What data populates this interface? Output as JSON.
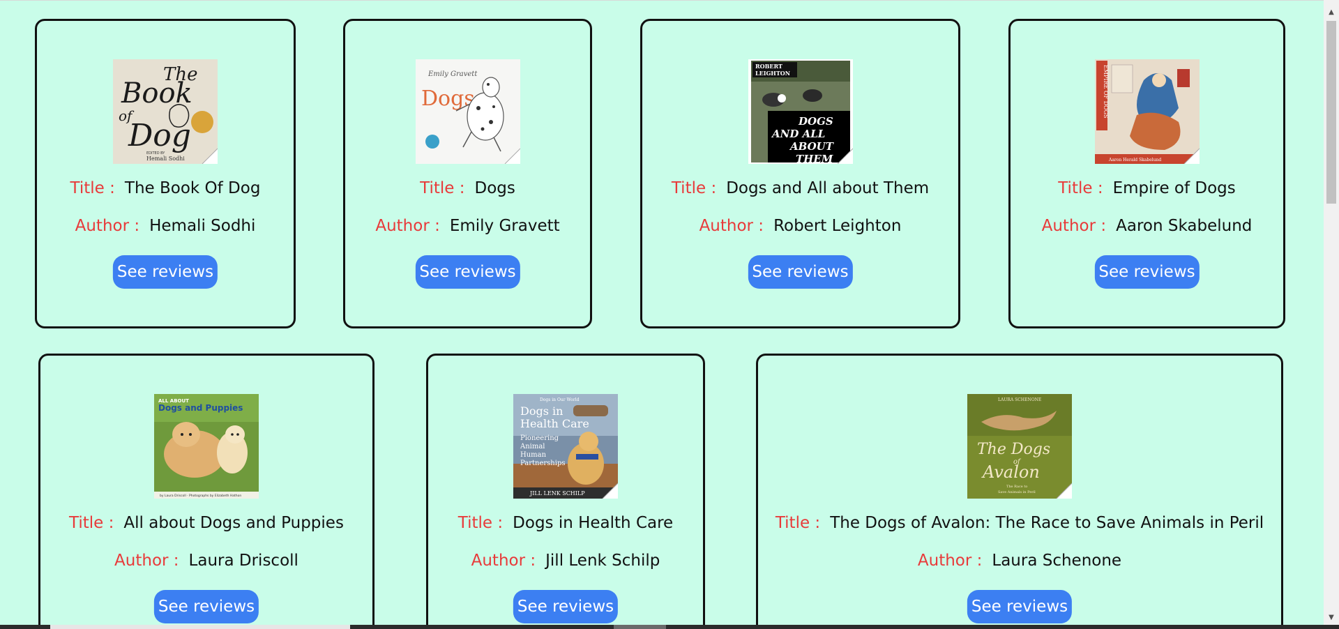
{
  "labels": {
    "title": "Title :",
    "author": "Author :",
    "button": "See reviews"
  },
  "books": [
    {
      "title": "The Book Of Dog",
      "author": "Hemali Sodhi"
    },
    {
      "title": "Dogs",
      "author": "Emily Gravett"
    },
    {
      "title": "Dogs and All about Them",
      "author": "Robert Leighton"
    },
    {
      "title": "Empire of Dogs",
      "author": "Aaron Skabelund"
    },
    {
      "title": "All about Dogs and Puppies",
      "author": "Laura Driscoll"
    },
    {
      "title": "Dogs in Health Care",
      "author": "Jill Lenk Schilp"
    },
    {
      "title": "The Dogs of Avalon: The Race to Save Animals in Peril",
      "author": "Laura Schenone"
    }
  ],
  "covers": {
    "book1": {
      "line1": "The",
      "line2": "Book",
      "line3": "of",
      "line4": "Dog",
      "editor": "EDITED BY",
      "editor_name": "Hemali Sodhi"
    },
    "book2": {
      "author": "Emily Gravett",
      "title": "Dogs"
    },
    "book3": {
      "author1": "ROBERT",
      "author2": "LEIGHTON",
      "line1": "DOGS",
      "line2": "AND ALL",
      "line3": "ABOUT",
      "line4": "THEM"
    },
    "book4": {
      "spine": "EMPIRE OF DOGS",
      "author": "Aaron Herald Skabelund"
    },
    "book5": {
      "line1": "ALL ABOUT",
      "line2": "Dogs and Puppies",
      "credit": "by Laura Driscoll · Photographs by Elizabeth Hathon"
    },
    "book6": {
      "series": "Dogs in Our World",
      "line1": "Dogs in",
      "line2": "Health Care",
      "sub1": "Pioneering",
      "sub2": "Animal",
      "sub3": "Human",
      "sub4": "Partnerships",
      "author": "JILL LENK SCHILP"
    },
    "book7": {
      "author": "LAURA SCHENONE",
      "line1": "The Dogs",
      "line2": "of",
      "line3": "Avalon",
      "sub1": "The Race to",
      "sub2": "Save Animals in Peril"
    }
  },
  "colors": {
    "background": "#c9fde9",
    "label": "#e83a3a",
    "button": "#3c7ff2",
    "border": "#111111"
  }
}
